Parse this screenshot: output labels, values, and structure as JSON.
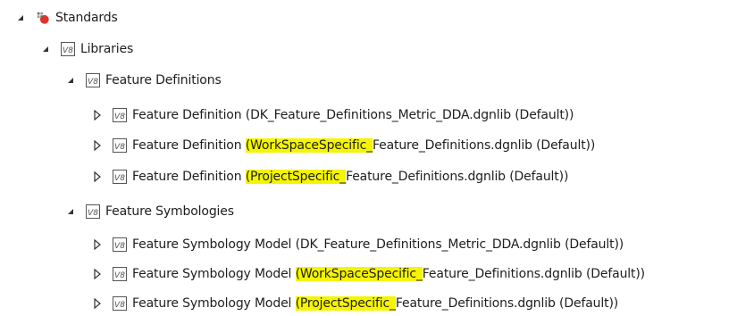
{
  "tree": {
    "root": {
      "label": "Standards",
      "icon": "standards-icon",
      "expanded": true
    },
    "libraries": {
      "label": "Libraries",
      "icon": "v8-icon",
      "expanded": true
    },
    "feature_definitions": {
      "label": "Feature Definitions",
      "icon": "v8-icon",
      "expanded": true,
      "items": [
        {
          "pre": "Feature Definition (",
          "hl": "",
          "post": "DK_Feature_Definitions_Metric_DDA.dgnlib (Default))",
          "expanded": false,
          "icon": "v8-icon"
        },
        {
          "pre": "Feature Definition ",
          "hl": "(WorkSpaceSpecific_",
          "post": "Feature_Definitions.dgnlib (Default))",
          "expanded": false,
          "icon": "v8-icon"
        },
        {
          "pre": "Feature Definition ",
          "hl": "(ProjectSpecific_",
          "post": "Feature_Definitions.dgnlib (Default))",
          "expanded": false,
          "icon": "v8-icon"
        }
      ]
    },
    "feature_symbologies": {
      "label": "Feature Symbologies",
      "icon": "v8-icon",
      "expanded": true,
      "items": [
        {
          "pre": "Feature Symbology Model (",
          "hl": "",
          "post": "DK_Feature_Definitions_Metric_DDA.dgnlib (Default))",
          "expanded": false,
          "icon": "v8-icon"
        },
        {
          "pre": "Feature Symbology Model ",
          "hl": "(WorkSpaceSpecific_",
          "post": "Feature_Definitions.dgnlib (Default))",
          "expanded": false,
          "icon": "v8-icon"
        },
        {
          "pre": "Feature Symbology Model ",
          "hl": "(ProjectSpecific_",
          "post": "Feature_Definitions.dgnlib (Default))",
          "expanded": false,
          "icon": "v8-icon"
        }
      ]
    }
  },
  "colors": {
    "highlight": "#f5f500",
    "text": "#1e1e1e"
  }
}
